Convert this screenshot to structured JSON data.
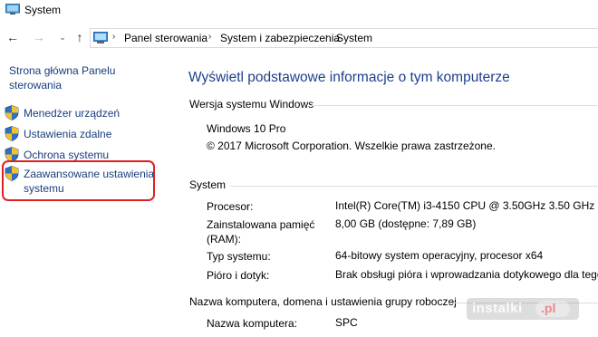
{
  "window": {
    "title": "System"
  },
  "navigation": {
    "breadcrumbs": [
      "Panel sterowania",
      "System i zabezpieczenia",
      "System"
    ]
  },
  "left_pane": {
    "home_link": "Strona główna Panelu sterowania",
    "tasks": [
      {
        "label": "Menedżer urządzeń"
      },
      {
        "label": "Ustawienia zdalne"
      },
      {
        "label": "Ochrona systemu"
      },
      {
        "label": "Zaawansowane ustawienia systemu"
      }
    ]
  },
  "main": {
    "title": "Wyświetl podstawowe informacje o tym komputerze",
    "edition": {
      "heading": "Wersja systemu Windows",
      "name": "Windows 10 Pro",
      "copyright": "© 2017 Microsoft Corporation. Wszelkie prawa zastrzeżone."
    },
    "system": {
      "heading": "System",
      "rows": [
        {
          "key": "Procesor:",
          "value": "Intel(R) Core(TM) i3-4150 CPU @ 3.50GHz   3.50 GHz"
        },
        {
          "key": "Zainstalowana pamięć (RAM):",
          "value": "8,00 GB (dostępne: 7,89 GB)"
        },
        {
          "key": "Typ systemu:",
          "value": "64-bitowy system operacyjny, procesor x64"
        },
        {
          "key": "Pióro i dotyk:",
          "value": "Brak obsługi pióra i wprowadzania dotykowego dla tego ek"
        }
      ]
    },
    "computer": {
      "heading": "Nazwa komputera, domena i ustawienia grupy roboczej",
      "rows": [
        {
          "key": "Nazwa komputera:",
          "value": "SPC"
        }
      ]
    }
  },
  "watermark": {
    "text": "instalki",
    "suffix": ".pl"
  },
  "colors": {
    "link": "#1a3d7c",
    "title": "#1e3f8c",
    "highlight": "#e02020"
  }
}
